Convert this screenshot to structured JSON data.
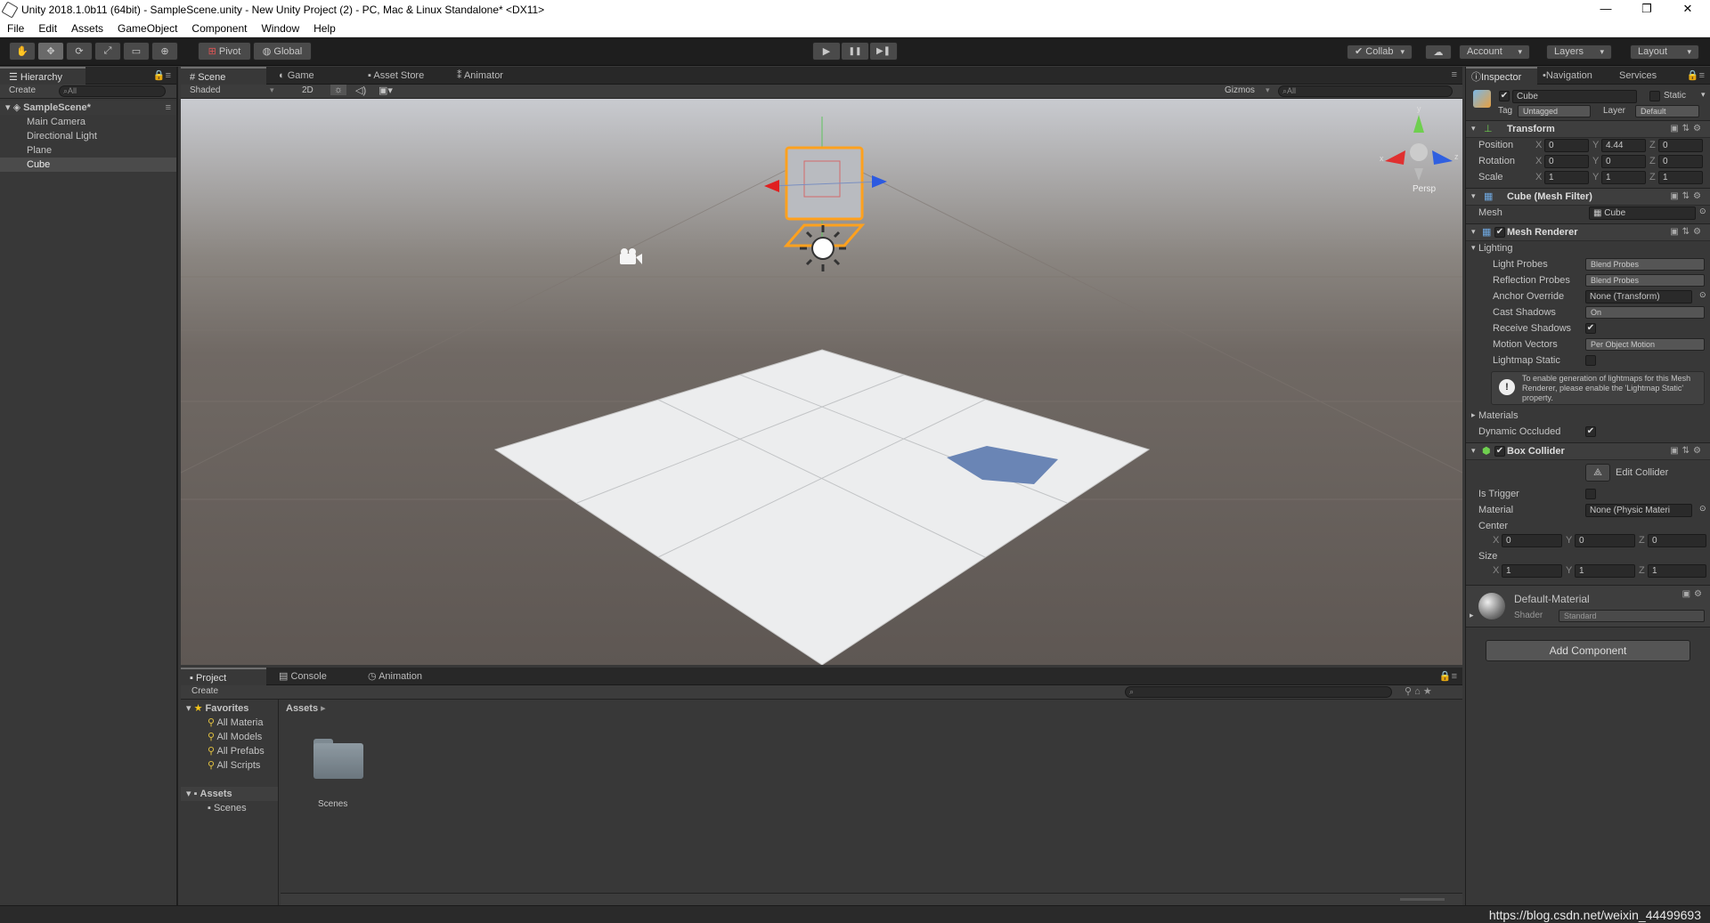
{
  "window": {
    "title": "Unity 2018.1.0b11 (64bit) - SampleScene.unity - New Unity Project (2) - PC, Mac & Linux Standalone* <DX11>",
    "minimize": "—",
    "maximize": "❐",
    "close": "✕"
  },
  "menu": [
    "File",
    "Edit",
    "Assets",
    "GameObject",
    "Component",
    "Window",
    "Help"
  ],
  "toolbar": {
    "tools": [
      "✋",
      "✥",
      "⟳",
      "⤢",
      "▭",
      "⊕"
    ],
    "pivot": "Pivot",
    "global": "Global",
    "play": "▶",
    "pause": "❚❚",
    "step": "▶❚",
    "collab": "Collab",
    "cloud": "☁",
    "account": "Account",
    "layers": "Layers",
    "layout": "Layout"
  },
  "hierarchy": {
    "tab": "Hierarchy",
    "create": "Create",
    "search": "All",
    "scene": "SampleScene*",
    "items": [
      "Main Camera",
      "Directional Light",
      "Plane",
      "Cube"
    ],
    "selected": "Cube"
  },
  "scene": {
    "tabs": [
      "Scene",
      "Game",
      "Asset Store",
      "Animator"
    ],
    "shading": "Shaded",
    "mode2d": "2D",
    "gizmos": "Gizmos",
    "search": "All",
    "persp": "Persp",
    "axis": {
      "x": "x",
      "y": "y",
      "z": "z"
    }
  },
  "inspector": {
    "tabs": [
      "Inspector",
      "Navigation",
      "Services"
    ],
    "object": {
      "name": "Cube",
      "static": "Static",
      "tag_label": "Tag",
      "tag": "Untagged",
      "layer_label": "Layer",
      "layer": "Default"
    },
    "transform": {
      "title": "Transform",
      "position": {
        "label": "Position",
        "x": "0",
        "y": "4.44",
        "z": "0"
      },
      "rotation": {
        "label": "Rotation",
        "x": "0",
        "y": "0",
        "z": "0"
      },
      "scale": {
        "label": "Scale",
        "x": "1",
        "y": "1",
        "z": "1"
      }
    },
    "mesh_filter": {
      "title": "Cube (Mesh Filter)",
      "mesh_label": "Mesh",
      "mesh": "Cube"
    },
    "mesh_renderer": {
      "title": "Mesh Renderer",
      "lighting": "Lighting",
      "light_probes": {
        "label": "Light Probes",
        "value": "Blend Probes"
      },
      "reflection_probes": {
        "label": "Reflection Probes",
        "value": "Blend Probes"
      },
      "anchor_override": {
        "label": "Anchor Override",
        "value": "None (Transform)"
      },
      "cast_shadows": {
        "label": "Cast Shadows",
        "value": "On"
      },
      "receive_shadows": {
        "label": "Receive Shadows"
      },
      "motion_vectors": {
        "label": "Motion Vectors",
        "value": "Per Object Motion"
      },
      "lightmap_static": {
        "label": "Lightmap Static"
      },
      "info": "To enable generation of lightmaps for this Mesh Renderer, please enable the 'Lightmap Static' property.",
      "materials": "Materials",
      "dynamic_occluded": "Dynamic Occluded"
    },
    "box_collider": {
      "title": "Box Collider",
      "edit": "Edit Collider",
      "is_trigger": "Is Trigger",
      "material_label": "Material",
      "material": "None (Physic Materi",
      "center": {
        "label": "Center",
        "x": "0",
        "y": "0",
        "z": "0"
      },
      "size": {
        "label": "Size",
        "x": "1",
        "y": "1",
        "z": "1"
      }
    },
    "material": {
      "name": "Default-Material",
      "shader_label": "Shader",
      "shader": "Standard"
    },
    "add_component": "Add Component"
  },
  "project": {
    "tabs": [
      "Project",
      "Console",
      "Animation"
    ],
    "create": "Create",
    "favorites": "Favorites",
    "fav_items": [
      "All Materia",
      "All Models",
      "All Prefabs",
      "All Scripts"
    ],
    "assets": "Assets",
    "asset_children": [
      "Scenes"
    ],
    "breadcrumb": "Assets",
    "folder": "Scenes"
  },
  "watermark": "https://blog.csdn.net/weixin_44499693"
}
